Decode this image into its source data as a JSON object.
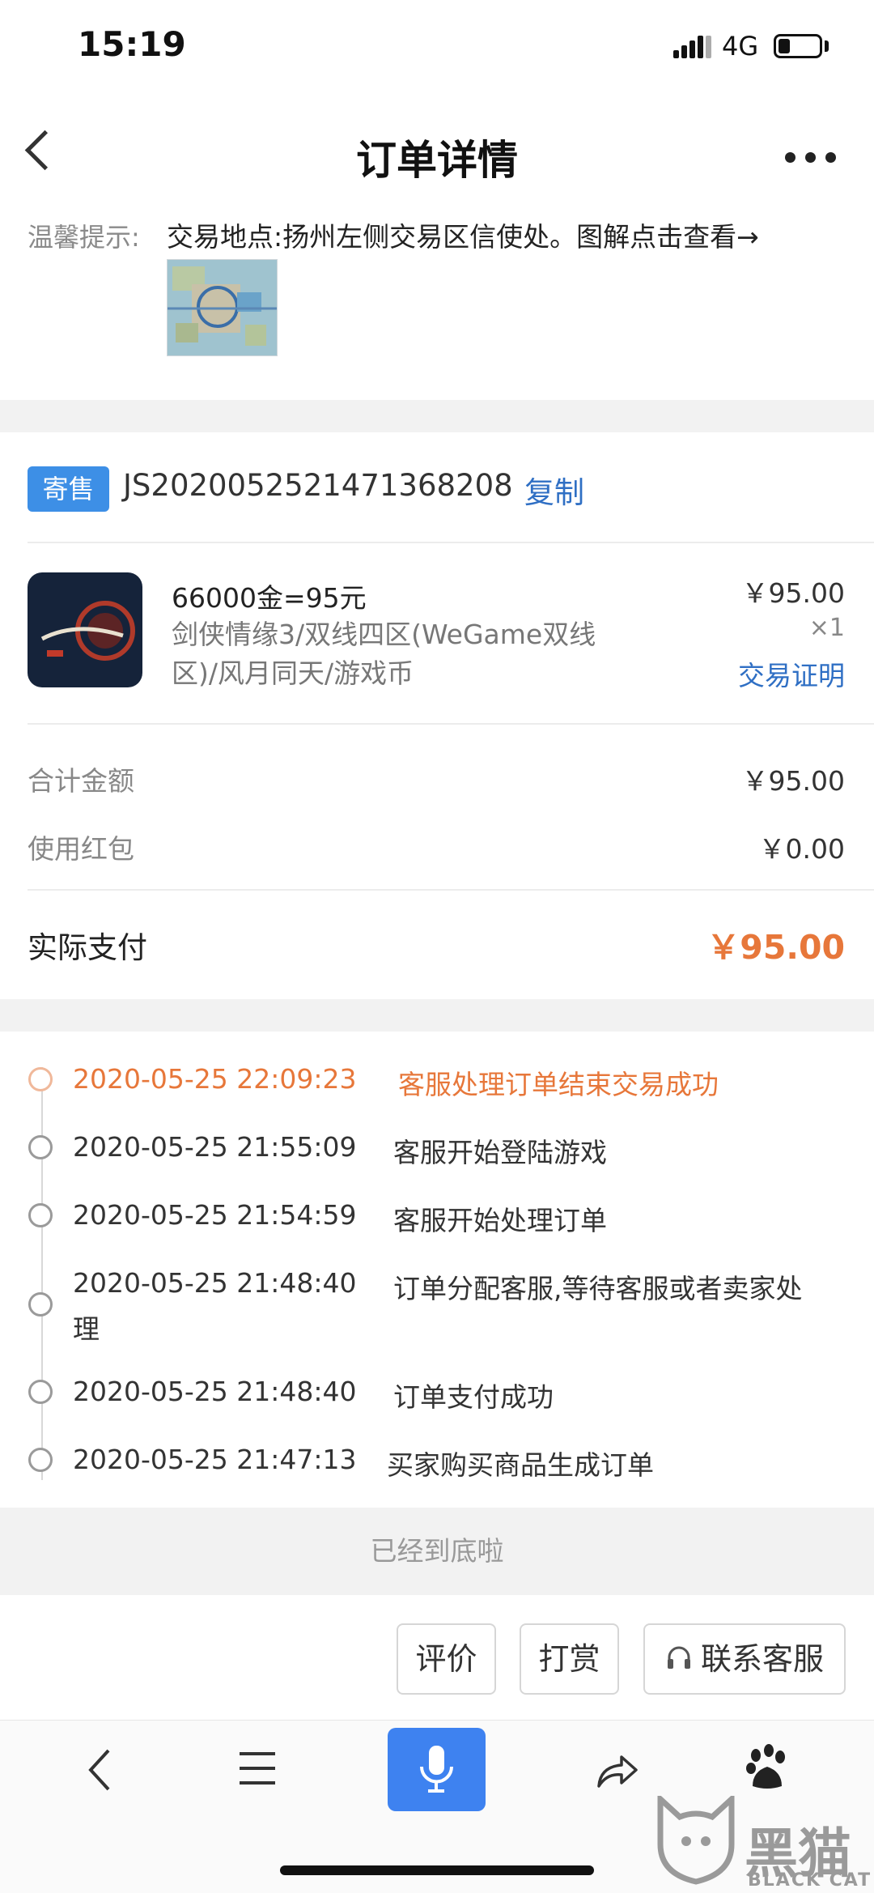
{
  "status_bar": {
    "time": "15:19",
    "network": "4G",
    "battery_level": 0.3
  },
  "nav": {
    "title": "订单详情",
    "back_icon": "chevron-left-icon",
    "more_icon": "more-horizontal-icon"
  },
  "tip": {
    "label": "温馨提示:",
    "text": "交易地点:扬州左侧交易区信使处。图解点击查看→"
  },
  "order": {
    "tag": "寄售",
    "number": "JS2020052521471368208",
    "copy_label": "复制"
  },
  "item": {
    "title": "66000金=95元",
    "desc_line1": "剑侠情缘3/双线四区(WeGame双线",
    "desc_line2": "区)/风月同天/游戏币",
    "price": "￥95.00",
    "qty": "×1",
    "proof_label": "交易证明"
  },
  "summary": [
    {
      "label": "合计金额",
      "value": "￥95.00"
    },
    {
      "label": "使用红包",
      "value": "￥0.00"
    }
  ],
  "payment": {
    "label": "实际支付",
    "value": "￥95.00"
  },
  "timeline": [
    {
      "time": "2020-05-25 22:09:23",
      "msg": "客服处理订单结束交易成功"
    },
    {
      "time": "2020-05-25 21:55:09",
      "msg": "客服开始登陆游戏"
    },
    {
      "time": "2020-05-25 21:54:59",
      "msg": "客服开始处理订单"
    },
    {
      "time": "2020-05-25 21:48:40",
      "msg": "订单分配客服,等待客服或者卖家处",
      "msg_cont": "理"
    },
    {
      "time": "2020-05-25 21:48:40",
      "msg": "订单支付成功"
    },
    {
      "time": "2020-05-25 21:47:13",
      "msg": "买家购买商品生成订单"
    }
  ],
  "end_text": "已经到底啦",
  "actions": {
    "review": "评价",
    "tip": "打赏",
    "contact": "联系客服"
  },
  "browser_bar": [
    "back-icon",
    "menu-icon",
    "microphone-icon",
    "share-icon",
    "baidu-paw-icon"
  ],
  "watermark": {
    "cn": "黑猫",
    "en": "BLACK CAT"
  },
  "colors": {
    "accent_blue": "#3d8fe6",
    "link_blue": "#2f6fc4",
    "price_orange": "#e7773a"
  }
}
